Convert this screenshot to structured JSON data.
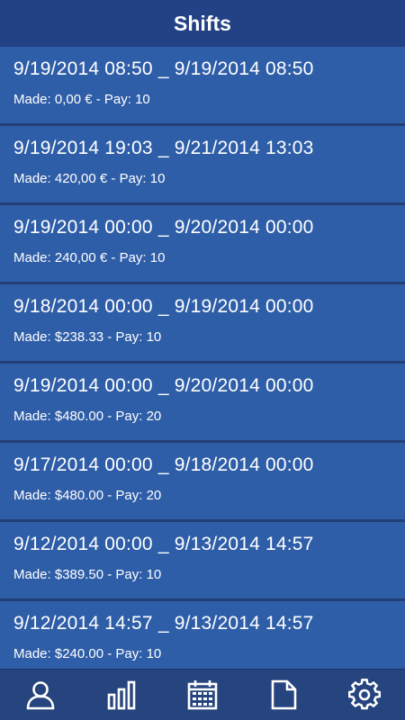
{
  "header": {
    "title": "Shifts"
  },
  "shifts": [
    {
      "range": "9/19/2014 08:50 _ 9/19/2014 08:50",
      "detail": "Made: 0,00 € - Pay: 10"
    },
    {
      "range": "9/19/2014 19:03 _ 9/21/2014 13:03",
      "detail": "Made: 420,00 € - Pay: 10"
    },
    {
      "range": "9/19/2014 00:00 _ 9/20/2014 00:00",
      "detail": "Made: 240,00 € - Pay: 10"
    },
    {
      "range": "9/18/2014 00:00 _ 9/19/2014 00:00",
      "detail": "Made: $238.33 - Pay: 10"
    },
    {
      "range": "9/19/2014 00:00 _ 9/20/2014 00:00",
      "detail": "Made: $480.00 - Pay: 20"
    },
    {
      "range": "9/17/2014 00:00 _ 9/18/2014 00:00",
      "detail": "Made: $480.00 - Pay: 20"
    },
    {
      "range": "9/12/2014 00:00 _ 9/13/2014 14:57",
      "detail": "Made: $389.50 - Pay: 10"
    },
    {
      "range": "9/12/2014 14:57 _ 9/13/2014 14:57",
      "detail": "Made: $240.00 - Pay: 10"
    }
  ],
  "tabs": [
    {
      "icon": "user-icon"
    },
    {
      "icon": "bar-chart-icon"
    },
    {
      "icon": "calendar-icon"
    },
    {
      "icon": "document-icon"
    },
    {
      "icon": "gear-icon"
    }
  ],
  "colors": {
    "header_bg": "#234286",
    "item_bg": "#2f5ea8",
    "divider": "#233f78",
    "tabbar_bg": "#26447e",
    "text": "#ffffff"
  }
}
